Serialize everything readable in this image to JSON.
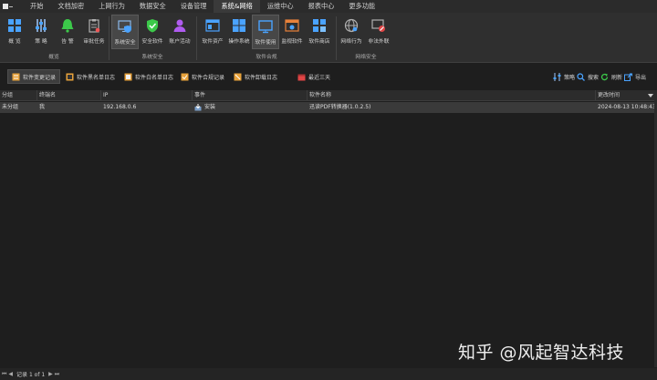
{
  "menu": {
    "items": [
      "开始",
      "文档加密",
      "上网行为",
      "数据安全",
      "设备管理",
      "系统&网络",
      "运维中心",
      "报表中心",
      "更多功能"
    ],
    "active_index": 5
  },
  "ribbon": {
    "groups": [
      {
        "title": "概览",
        "buttons": [
          {
            "label": "概 览",
            "icon": "grid-icon"
          },
          {
            "label": "策 略",
            "icon": "sliders-icon"
          },
          {
            "label": "告 警",
            "icon": "bell-icon"
          },
          {
            "label": "审批任务",
            "icon": "clipboard-icon"
          }
        ]
      },
      {
        "title": "系统安全",
        "buttons": [
          {
            "label": "系统安全",
            "icon": "monitor-shield-icon"
          },
          {
            "label": "安全软件",
            "icon": "shield-icon"
          },
          {
            "label": "账户活动",
            "icon": "user-icon"
          }
        ]
      },
      {
        "title": "软件合规",
        "buttons": [
          {
            "label": "软件资产",
            "icon": "window-icon"
          },
          {
            "label": "操作系统",
            "icon": "windows-icon"
          },
          {
            "label": "软件使用",
            "icon": "monitor-icon"
          },
          {
            "label": "监视软件",
            "icon": "eye-window-icon"
          },
          {
            "label": "软件商店",
            "icon": "store-icon"
          }
        ]
      },
      {
        "title": "网络安全",
        "buttons": [
          {
            "label": "网络行为",
            "icon": "globe-icon"
          },
          {
            "label": "非法外联",
            "icon": "network-block-icon"
          }
        ]
      }
    ],
    "selected": "软件使用"
  },
  "toolbar": {
    "tabs": [
      "软件变更记录",
      "软件黑名单日志",
      "软件白名单日志",
      "软件合规记录",
      "软件卸载日志"
    ],
    "active_tab": "软件变更记录",
    "range": "最近三天",
    "actions": [
      "策略",
      "搜索",
      "刷新",
      "导出"
    ]
  },
  "grid": {
    "columns": [
      "分组",
      "终端名",
      "IP",
      "事件",
      "软件名称",
      "更改时间"
    ],
    "rows": [
      {
        "group": "未分组",
        "terminal": "我",
        "ip": "192.168.0.6",
        "event": "安装",
        "software": "迅读PDF转换器(1.0.2.5)",
        "time": "2024-08-13 10:48:43"
      }
    ]
  },
  "status": {
    "records": "记录 1 of 1"
  },
  "watermark": "知乎 @风起智达科技"
}
